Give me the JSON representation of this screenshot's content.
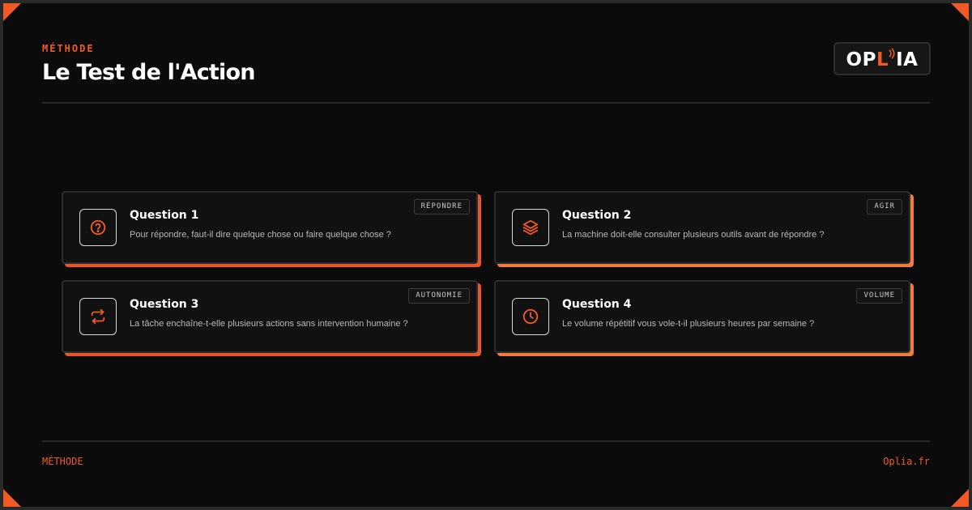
{
  "header": {
    "eyebrow": "MÉTHODE",
    "title": "Le Test de l'Action",
    "logo": {
      "prefix": "OP",
      "accent": "L",
      "suffix": "IA"
    }
  },
  "cards": [
    {
      "icon": "question-circle-icon",
      "tag": "RÉPONDRE",
      "title": "Question 1",
      "text": "Pour répondre, faut-il dire quelque chose ou faire quelque chose ?"
    },
    {
      "icon": "layers-icon",
      "tag": "AGIR",
      "title": "Question 2",
      "text": "La machine doit-elle consulter plusieurs outils avant de répondre ?"
    },
    {
      "icon": "repeat-arrows-icon",
      "tag": "AUTONOMIE",
      "title": "Question 3",
      "text": "La tâche enchaîne-t-elle plusieurs actions sans intervention humaine ?"
    },
    {
      "icon": "clock-icon",
      "tag": "VOLUME",
      "title": "Question 4",
      "text": "Le volume répétitif vous vole-t-il plusieurs heures par semaine ?"
    }
  ],
  "footer": {
    "left": "MÉTHODE",
    "right": "Oplia.fr"
  },
  "colors": {
    "accent": "#f15a24",
    "accent_light": "#f07b3c",
    "background": "#0b0b0b",
    "card_background": "#111111"
  }
}
